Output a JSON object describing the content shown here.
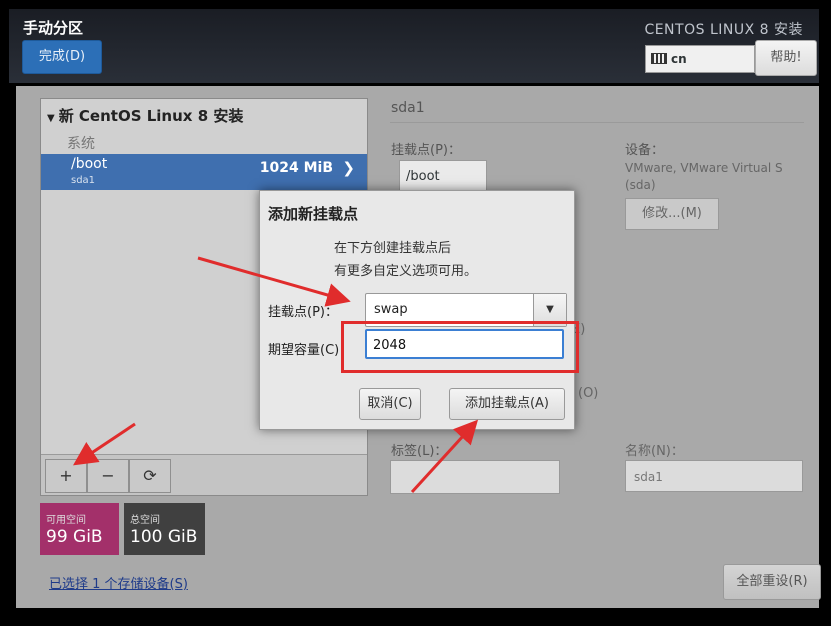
{
  "header": {
    "app_title": "手动分区",
    "done_button": "完成(D)",
    "installer_title": "CENTOS LINUX 8 安装",
    "keyboard_layout": "cn",
    "help_button": "帮助!"
  },
  "left_pane": {
    "tree_title": "新 CentOS Linux 8 安装",
    "section_label": "系统",
    "selected_item": {
      "mount": "/boot",
      "device": "sda1",
      "size": "1024 MiB"
    },
    "toolbar": {
      "add": "+",
      "remove": "−",
      "refresh": "⟳"
    }
  },
  "space": {
    "available_label": "可用空间",
    "available_value": "99 GiB",
    "total_label": "总空间",
    "total_value": "100 GiB"
  },
  "storage_link": "已选择 1 个存储设备(S)",
  "reset_button": "全部重设(R)",
  "right_pane": {
    "title": "sda1",
    "mount_point_label": "挂载点(P)：",
    "mount_point_value": "/boot",
    "device_label": "设备：",
    "device_info_1": "VMware, VMware Virtual S",
    "device_info_2": "(sda)",
    "modify_button": "修改...(M)",
    "frag_e": "E)",
    "frag_o": "(O)",
    "label_label": "标签(L)：",
    "name_label": "名称(N)：",
    "name_value": "sda1"
  },
  "dialog": {
    "title": "添加新挂载点",
    "desc_line1": "在下方创建挂载点后",
    "desc_line2": "有更多自定义选项可用。",
    "mount_label": "挂载点(P)：",
    "mount_value": "swap",
    "capacity_label": "期望容量(C)：",
    "capacity_value": "2048",
    "cancel_button": "取消(C)",
    "add_button": "添加挂载点(A)"
  },
  "colors": {
    "annotation": "#e02c2c",
    "selection": "#3f6faf",
    "available": "#a3306a",
    "total": "#404040",
    "done": "#2c6fb7"
  }
}
